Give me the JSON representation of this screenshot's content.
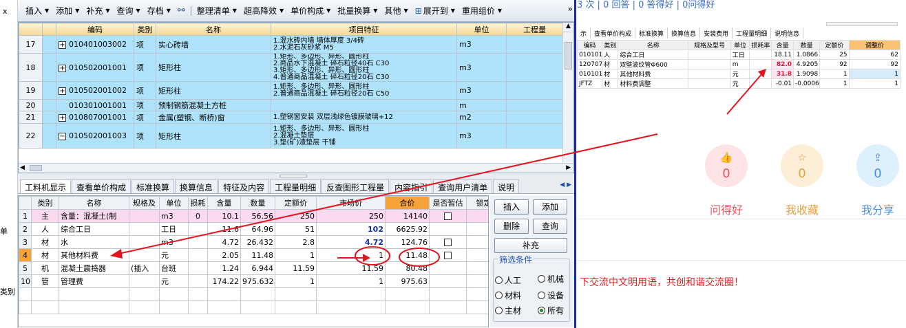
{
  "left_strip": {
    "items": [
      "x",
      "单",
      "类别"
    ]
  },
  "toolbar": {
    "items": [
      "插入",
      "添加",
      "补充",
      "查询",
      "存档",
      "整理清单",
      "超高降效",
      "单价构成",
      "批量换算",
      "其他",
      "展开到",
      "重用组价"
    ],
    "more": "»"
  },
  "top_grid": {
    "headers": [
      "编码",
      "类别",
      "名称",
      "项目特征",
      "单位",
      "工程量"
    ],
    "rows": [
      {
        "num": "17",
        "toggle": "+",
        "code": "010401003002",
        "type": "项",
        "name": "实心砖墙",
        "feature": "1.混水砖内墙 墙体厚度 3/4砖\n2.水泥石灰砂浆 M5",
        "unit": "m3",
        "qty": ""
      },
      {
        "num": "18",
        "toggle": "+",
        "code": "010502001001",
        "type": "项",
        "name": "矩形柱",
        "feature": "1.矩形、多边形、异形、圆形柱\n2.商品水下混凝土 碎石粒径40石 C30\n3.矩形、多边形、异形、圆形柱\n4.普通商品混凝土 碎石粒径20石 C30",
        "unit": "m3",
        "qty": ""
      },
      {
        "num": "19",
        "toggle": "+",
        "code": "010502001002",
        "type": "项",
        "name": "矩形柱",
        "feature": "1.矩形、多边形、异形、圆形柱\n2.普通商品混凝土 碎石粒径20石 C50",
        "unit": "m3",
        "qty": ""
      },
      {
        "num": "20",
        "toggle": "",
        "code": "010301001001",
        "type": "项",
        "name": "预制钢筋混凝土方桩",
        "feature": "",
        "unit": "m",
        "qty": ""
      },
      {
        "num": "21",
        "toggle": "+",
        "code": "010807001001",
        "type": "项",
        "name": "金属(塑钢、断桥)窗",
        "feature": "1.塑钢窗安装 双层浅绿色镀膜玻璃+12",
        "unit": "m2",
        "qty": ""
      },
      {
        "num": "22",
        "toggle": "−",
        "code": "010502001003",
        "type": "项",
        "name": "矩形柱",
        "feature": "1.矩形、多边形、异形、圆形柱\n2.混凝土垫层\n3.垫(矿)渣垫层 干铺",
        "unit": "m3",
        "qty": ""
      }
    ]
  },
  "tabs": [
    "工料机显示",
    "查看单价构成",
    "标准换算",
    "换算信息",
    "特征及内容",
    "工程量明细",
    "反查图形工程量",
    "内容指引",
    "查询用户清单",
    "说明"
  ],
  "bottom_grid": {
    "headers": [
      "类别",
      "名称",
      "规格及",
      "单位",
      "损耗",
      "含量",
      "数量",
      "定额价",
      "市场价",
      "合价",
      "是否暂估",
      "锁定"
    ],
    "rows": [
      {
        "num": "1",
        "type": "主",
        "name": "含量：混凝土(制",
        "spec": "",
        "unit": "m3",
        "loss": "0",
        "amount": "10.1",
        "qty": "56.56",
        "quota": "250",
        "market": "250",
        "total": "14140",
        "est": true
      },
      {
        "num": "2",
        "type": "人",
        "name": "综合工日",
        "spec": "",
        "unit": "工日",
        "loss": "",
        "amount": "11.6",
        "qty": "64.96",
        "quota": "51",
        "market": "102",
        "total": "6625.92",
        "est": false
      },
      {
        "num": "3",
        "type": "材",
        "name": "水",
        "spec": "",
        "unit": "m3",
        "loss": "",
        "amount": "4.72",
        "qty": "26.432",
        "quota": "2.8",
        "market": "4.72",
        "total": "124.76",
        "est": true
      },
      {
        "num": "4",
        "type": "材",
        "name": "其他材料费",
        "spec": "",
        "unit": "元",
        "loss": "",
        "amount": "2.05",
        "qty": "11.48",
        "quota": "1",
        "market": "1",
        "total": "11.48",
        "est": true
      },
      {
        "num": "5",
        "type": "机",
        "name": "混凝土震捣器",
        "spec": "(插入",
        "unit": "台班",
        "loss": "",
        "amount": "1.24",
        "qty": "6.944",
        "quota": "11.59",
        "market": "11.59",
        "total": "80.48",
        "est": false
      },
      {
        "num": "10",
        "type": "管",
        "name": "管理费",
        "spec": "",
        "unit": "元",
        "loss": "",
        "amount": "174.22",
        "qty": "975.632",
        "quota": "1",
        "market": "1",
        "total": "975.63",
        "est": false
      }
    ]
  },
  "control_panel": {
    "insert": "插入",
    "add": "添加",
    "delete": "删除",
    "query": "查询",
    "supplement": "补充",
    "filter_title": "筛选条件",
    "options": [
      "人工",
      "机械",
      "材料",
      "设备",
      "主材",
      "所有"
    ],
    "selected": "所有"
  },
  "web": {
    "stats": "3 次 | 0 回答 | 0 答得好 | 0问得好",
    "mini_tabs": [
      "示",
      "查看单价构成",
      "标准换算",
      "换算信息",
      "安装费用",
      "工程量明细",
      "说明信息"
    ],
    "mini_headers": [
      "编码",
      "类别",
      "名称",
      "规格及型号",
      "单位",
      "损耗率",
      "含量",
      "数量",
      "定额价",
      "调整价"
    ],
    "mini_rows": [
      [
        "010101",
        "人",
        "综合工日",
        "",
        "工日",
        "",
        "18.11",
        "1.0866",
        "25",
        "62"
      ],
      [
        "120707",
        "材",
        "双壁波纹管Φ600",
        "",
        "m",
        "",
        "82.0",
        "4.9205",
        "92",
        "92"
      ],
      [
        "010101",
        "材",
        "其他材料费",
        "",
        "元",
        "",
        "31.8",
        "1.9098",
        "1",
        "1"
      ],
      [
        "JFTZ",
        "材",
        "材料费调整",
        "",
        "元",
        "",
        "-0.01",
        "-0.0006",
        "1",
        "1"
      ]
    ],
    "actions": [
      {
        "label": "问得好",
        "count": "0",
        "icon": "thumb-up-icon",
        "color": "#e8555f",
        "bg": "#fde3e5"
      },
      {
        "label": "我收藏",
        "count": "0",
        "icon": "star-icon",
        "color": "#e3a23e",
        "bg": "#fdeed7"
      },
      {
        "label": "我分享",
        "count": "0",
        "icon": "share-icon",
        "color": "#4a90d9",
        "bg": "#def0fb"
      }
    ],
    "notice": "下交流中文明用语，共创和谐交流圈！"
  },
  "colors": {
    "selected_row": "#aee3fb",
    "header_gold": "#f3d894",
    "annotation_red": "#e4141e",
    "total_header": "#f7a33a"
  }
}
